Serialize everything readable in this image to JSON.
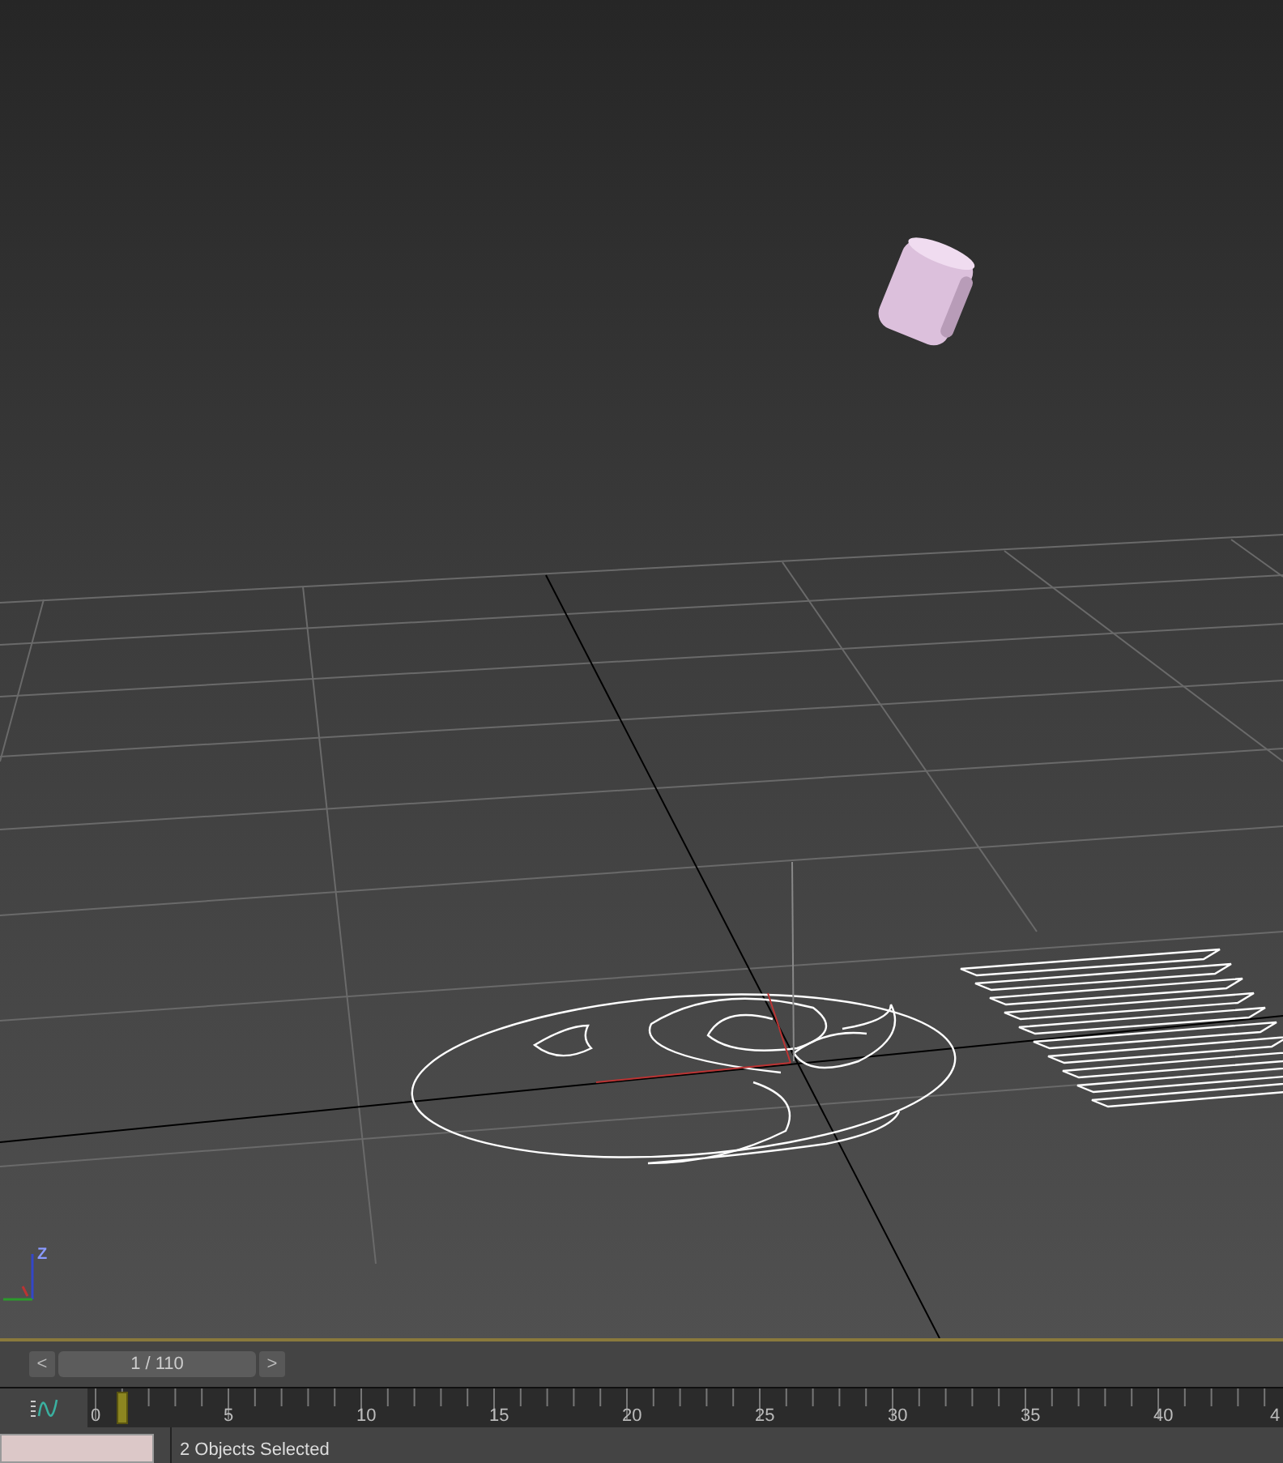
{
  "viewport": {
    "axis_label": "Z"
  },
  "time_slider": {
    "prev": "<",
    "counter": "1 / 110",
    "next": ">"
  },
  "track_bar": {
    "level": 0.022,
    "labels": [
      "0",
      "5",
      "10",
      "15",
      "20",
      "25",
      "30",
      "35",
      "40",
      "4"
    ]
  },
  "status_bar": {
    "message": "2 Objects Selected"
  }
}
